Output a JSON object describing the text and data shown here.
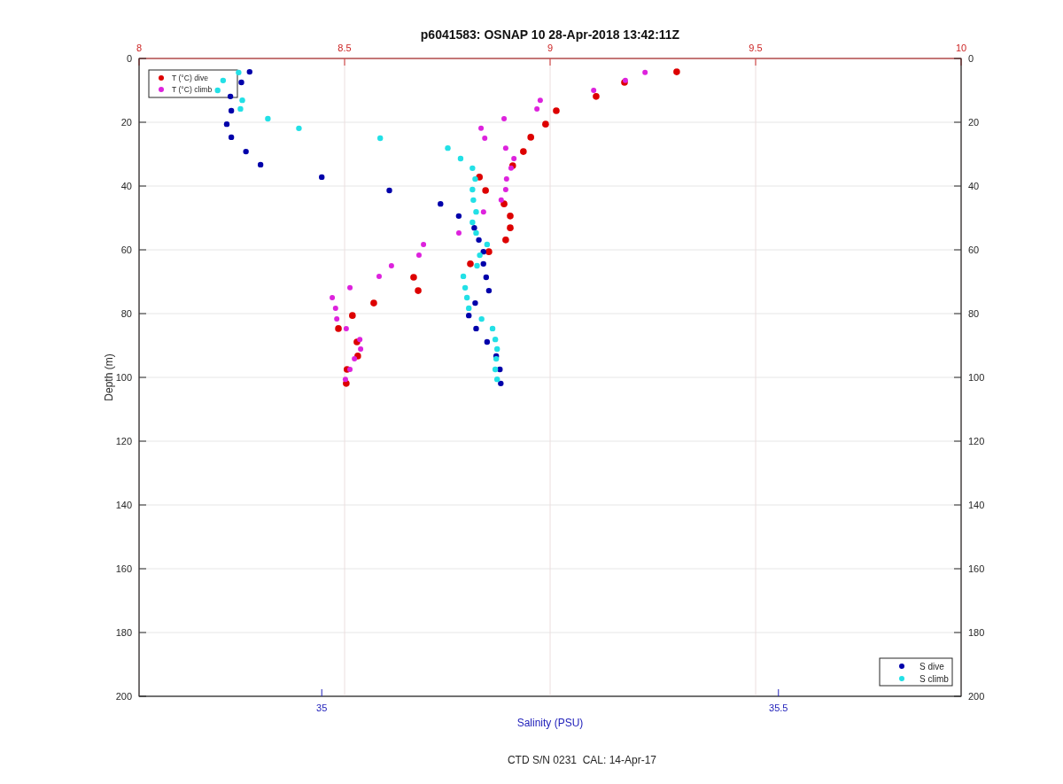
{
  "figure": {
    "title": "p6041583: OSNAP 10 28-Apr-2018 13:42:11Z",
    "footer": "CTD S/N 0231  CAL: 14-Apr-17"
  },
  "plots": [
    {
      "chart_data": {
        "type": "scatter",
        "legend": "upper left",
        "ylabel": "Depth (m)",
        "xlim": [
          8,
          10
        ],
        "ylim": [
          200,
          0
        ],
        "xticks": [
          8,
          8.5,
          9,
          9.5,
          10
        ],
        "yticks": [
          0,
          20,
          40,
          60,
          80,
          100,
          120,
          140,
          160,
          180,
          200
        ],
        "series": [
          {
            "name": "T (°C) dive",
            "color": "#dd0000",
            "x": [
              9.308,
              9.181,
              9.112,
              9.015,
              8.989,
              8.953,
              8.935,
              8.909,
              8.828,
              8.843,
              8.888,
              8.903,
              8.903,
              8.892,
              8.851,
              8.806,
              8.668,
              8.679,
              8.571,
              8.519,
              8.485,
              8.53,
              8.532,
              8.506,
              8.504
            ],
            "values": [
              4.2,
              7.5,
              11.9,
              16.4,
              20.6,
              24.7,
              29.2,
              33.6,
              37.2,
              41.4,
              45.6,
              49.4,
              53.1,
              56.9,
              60.6,
              64.4,
              68.6,
              72.8,
              76.7,
              80.6,
              84.7,
              88.9,
              93.3,
              97.5,
              101.9
            ]
          },
          {
            "name": "T (°C) climb",
            "color": "#dd22dd",
            "x": [
              9.231,
              9.183,
              9.106,
              8.976,
              8.968,
              8.888,
              8.832,
              8.841,
              8.892,
              8.912,
              8.905,
              8.894,
              8.892,
              8.881,
              8.838,
              8.778,
              8.692,
              8.681,
              8.614,
              8.584,
              8.513,
              8.47,
              8.478,
              8.481,
              8.504,
              8.537,
              8.539,
              8.524,
              8.513,
              8.502
            ],
            "values": [
              4.4,
              6.9,
              10,
              13.1,
              15.8,
              18.9,
              21.9,
              25,
              28.1,
              31.4,
              34.4,
              37.8,
              41.1,
              44.4,
              48.1,
              54.7,
              58.3,
              61.7,
              65,
              68.3,
              71.9,
              75,
              78.3,
              81.7,
              84.7,
              88.1,
              91.1,
              94.2,
              97.5,
              100.6
            ]
          }
        ]
      }
    },
    {
      "chart_data": {
        "type": "scatter",
        "legend": "lower right",
        "xlabel": "Salinity (PSU)",
        "xlim": [
          34.8,
          35.7
        ],
        "ylim": [
          200,
          0
        ],
        "xticks": [
          35,
          35.5
        ],
        "yticks": [
          0,
          20,
          40,
          60,
          80,
          100,
          120,
          140,
          160,
          180,
          200
        ],
        "series": [
          {
            "name": "S dive",
            "color": "#0000aa",
            "x": [
              34.921,
              34.912,
              34.9,
              34.901,
              34.896,
              34.901,
              34.917,
              34.933,
              35,
              35.074,
              35.13,
              35.15,
              35.167,
              35.172,
              35.177,
              35.177,
              35.18,
              35.183,
              35.168,
              35.161,
              35.169,
              35.181,
              35.191,
              35.195,
              35.196
            ],
            "values": [
              4.2,
              7.5,
              11.9,
              16.4,
              20.6,
              24.7,
              29.2,
              33.3,
              37.2,
              41.4,
              45.6,
              49.4,
              53.1,
              56.9,
              60.6,
              64.4,
              68.6,
              72.8,
              76.7,
              80.6,
              84.7,
              88.9,
              93.3,
              97.5,
              101.9
            ]
          },
          {
            "name": "S climb",
            "color": "#22e0e6",
            "x": [
              34.909,
              34.892,
              34.886,
              34.913,
              34.911,
              34.941,
              34.975,
              35.064,
              35.138,
              35.152,
              35.165,
              35.168,
              35.165,
              35.166,
              35.169,
              35.165,
              35.169,
              35.181,
              35.173,
              35.17,
              35.155,
              35.157,
              35.159,
              35.161,
              35.175,
              35.187,
              35.19,
              35.192,
              35.191,
              35.19,
              35.192
            ],
            "values": [
              4.4,
              6.9,
              10,
              13.1,
              15.8,
              18.9,
              21.9,
              25,
              28.1,
              31.4,
              34.4,
              37.8,
              41.1,
              44.4,
              48.1,
              51.4,
              54.7,
              58.3,
              61.7,
              65,
              68.3,
              71.9,
              75,
              78.3,
              81.7,
              84.7,
              88.1,
              91.1,
              94.2,
              97.5,
              100.6
            ]
          }
        ]
      }
    }
  ]
}
